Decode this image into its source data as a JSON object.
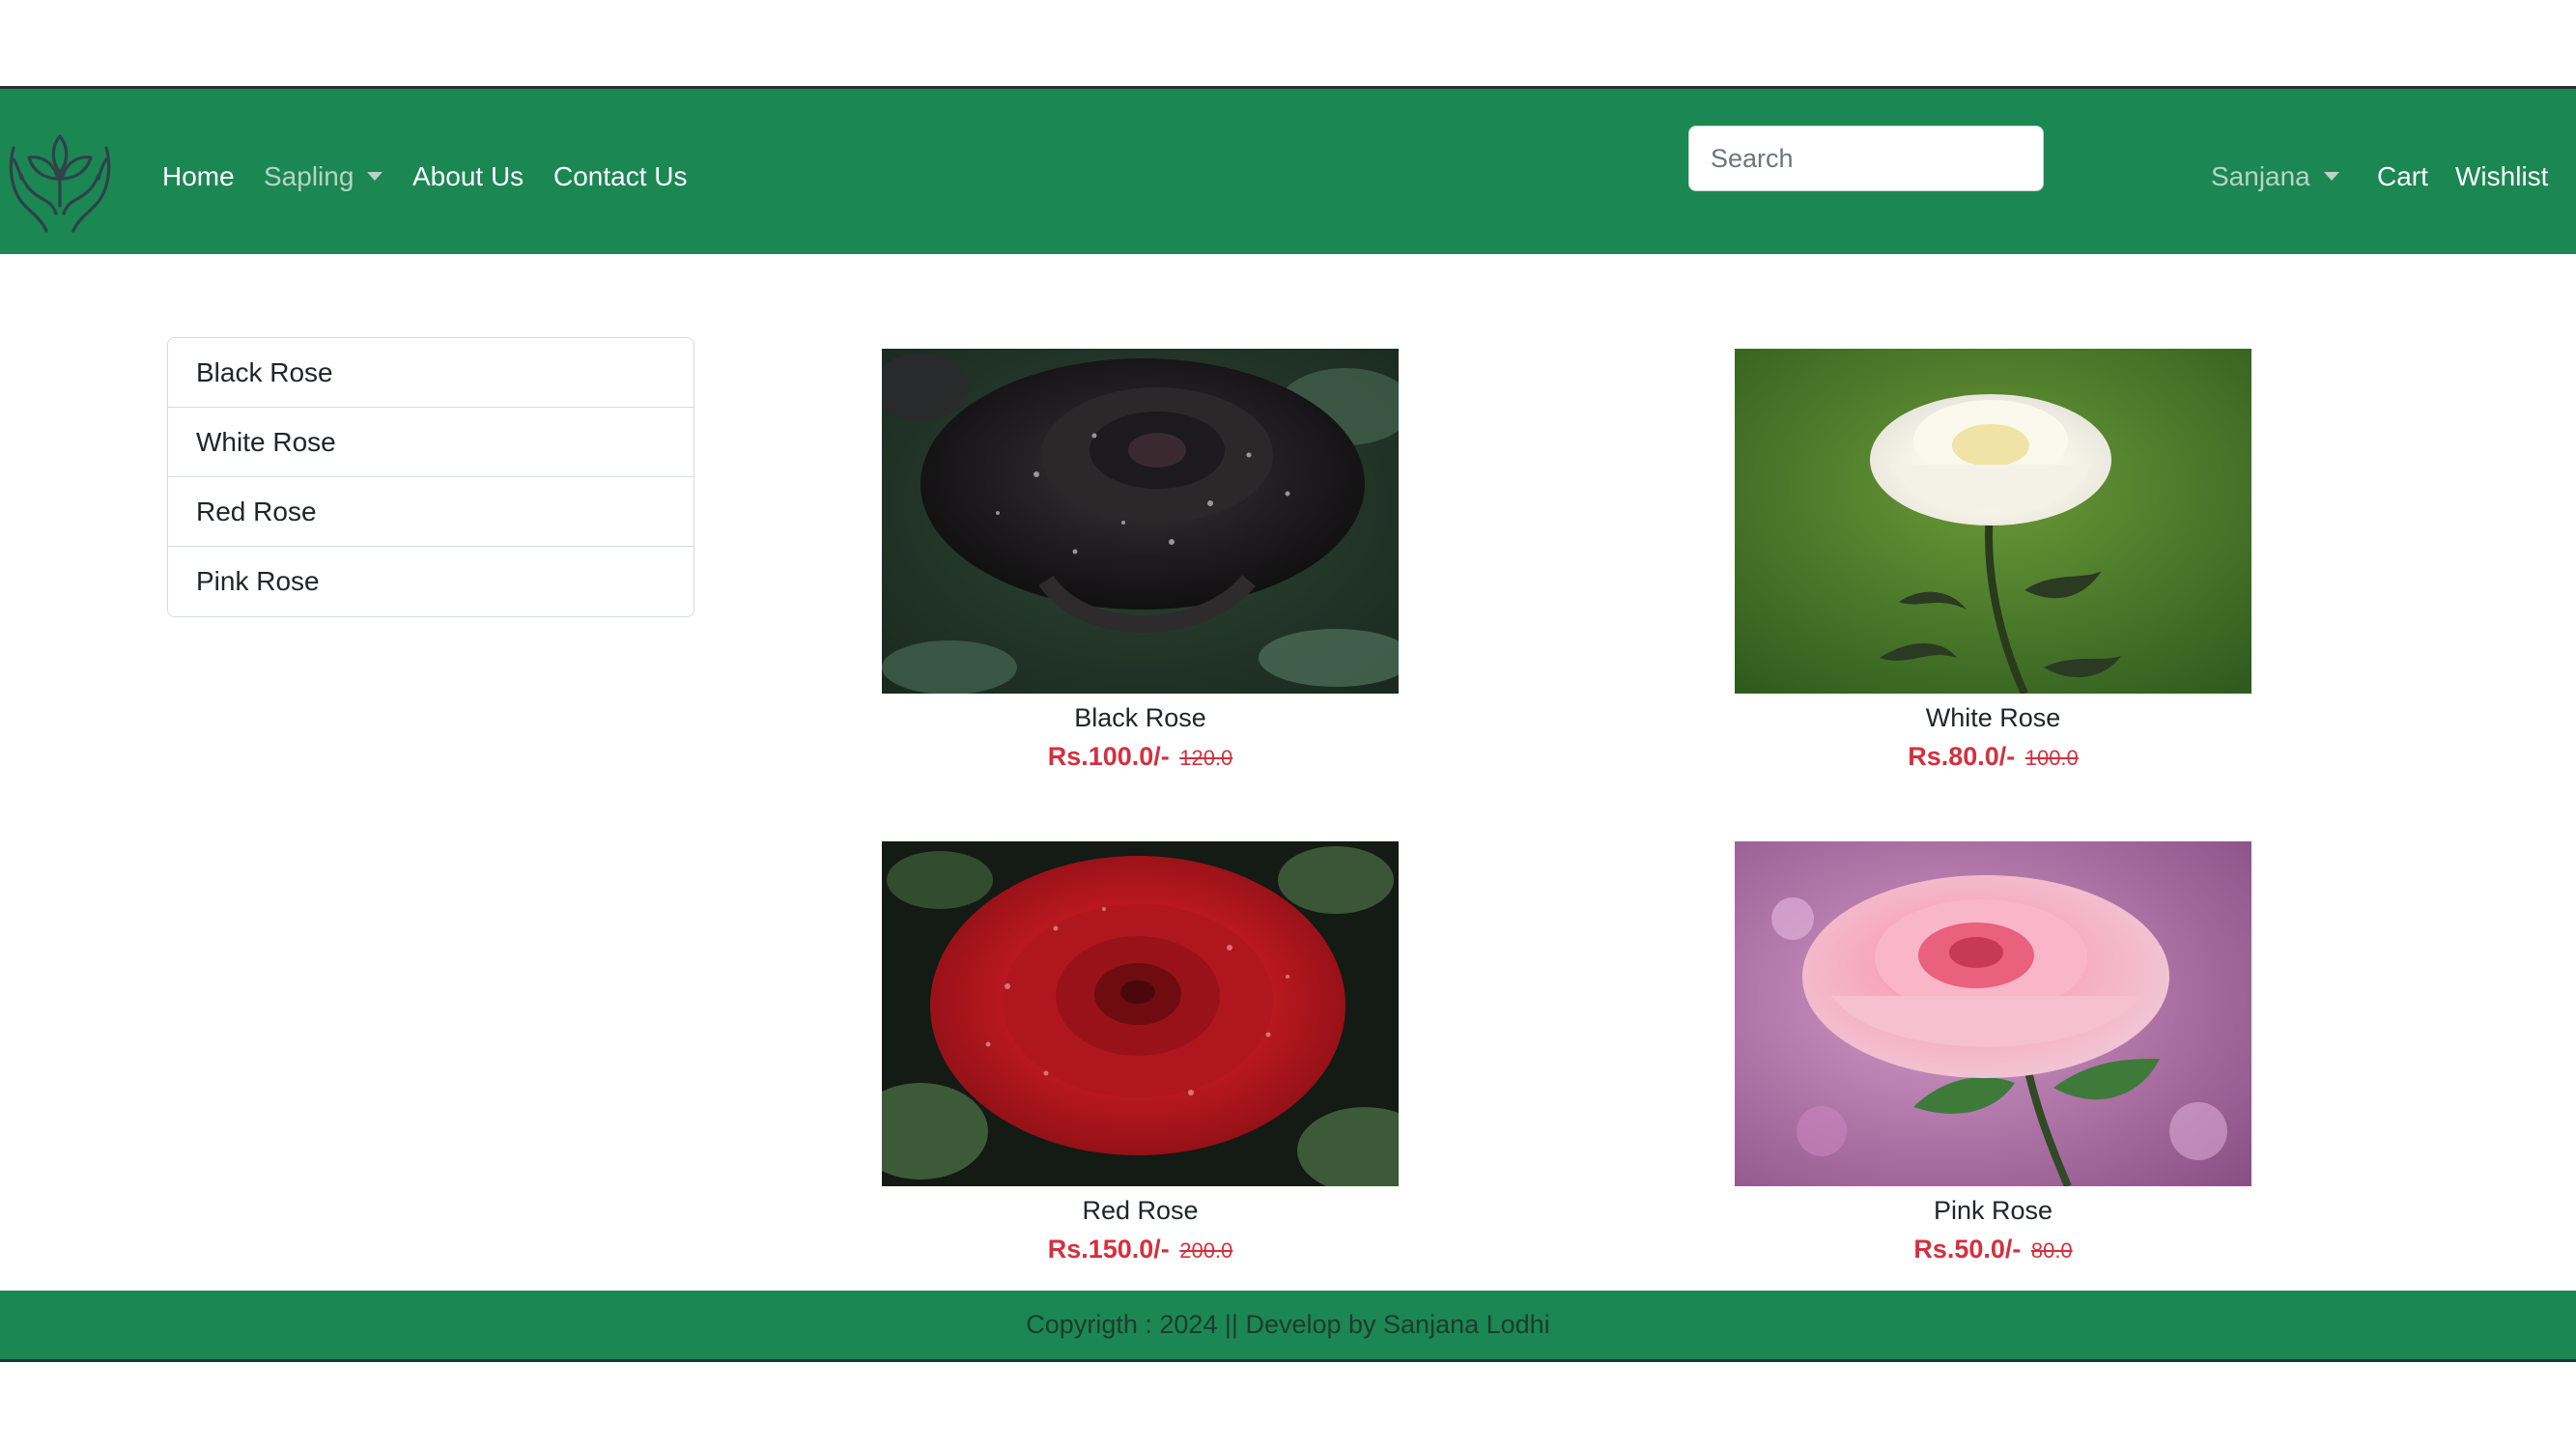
{
  "navbar": {
    "links": {
      "home": "Home",
      "sapling": "Sapling",
      "about": "About Us",
      "contact": "Contact Us",
      "user": "Sanjana",
      "cart": "Cart",
      "wishlist": "Wishlist"
    },
    "search": {
      "placeholder": "Search",
      "value": ""
    },
    "colors": {
      "background": "#1b8753",
      "muted_link": "#b9d3c5"
    }
  },
  "sidebar": {
    "items": [
      {
        "label": "Black Rose"
      },
      {
        "label": "White Rose"
      },
      {
        "label": "Red Rose"
      },
      {
        "label": "Pink Rose"
      }
    ]
  },
  "products": [
    {
      "name": "Black Rose",
      "price": "Rs.100.0/-",
      "old_price": "120.0",
      "image": "black-rose-photo"
    },
    {
      "name": "White Rose",
      "price": "Rs.80.0/-",
      "old_price": "100.0",
      "image": "white-rose-photo"
    },
    {
      "name": "Red Rose",
      "price": "Rs.150.0/-",
      "old_price": "200.0",
      "image": "red-rose-photo"
    },
    {
      "name": "Pink Rose",
      "price": "Rs.50.0/-",
      "old_price": "80.0",
      "image": "pink-rose-photo"
    }
  ],
  "footer": {
    "text": "Copyrigth : 2024 || Develop by Sanjana Lodhi"
  },
  "colors": {
    "price": "#d2313f",
    "footer_background": "#1b8753"
  }
}
